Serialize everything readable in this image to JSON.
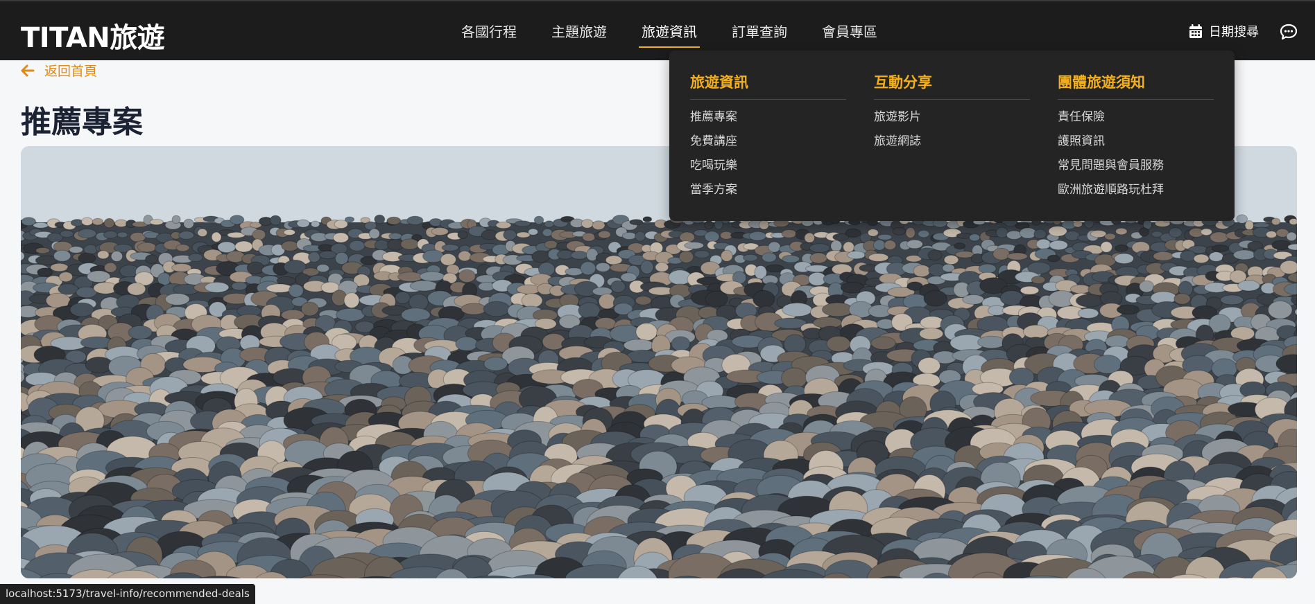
{
  "brand": {
    "logo": "TITAN旅遊"
  },
  "nav": {
    "items": [
      {
        "label": "各國行程"
      },
      {
        "label": "主題旅遊"
      },
      {
        "label": "旅遊資訊"
      },
      {
        "label": "訂單查詢"
      },
      {
        "label": "會員專區"
      }
    ],
    "active_index": 2,
    "date_search_label": "日期搜尋"
  },
  "page": {
    "back_label": "返回首頁",
    "title": "推薦專案",
    "hero_icon": "pebble-beach-photo"
  },
  "mega_menu": {
    "columns": [
      {
        "heading": "旅遊資訊",
        "links": [
          "推薦專案",
          "免費講座",
          "吃喝玩樂",
          "當季方案"
        ]
      },
      {
        "heading": "互動分享",
        "links": [
          "旅遊影片",
          "旅遊網誌"
        ]
      },
      {
        "heading": "團體旅遊須知",
        "links": [
          "責任保險",
          "護照資訊",
          "常見問題與會員服務",
          "歐洲旅遊順路玩杜拜"
        ]
      }
    ]
  },
  "status_bar": {
    "url": "localhost:5173/travel-info/recommended-deals"
  },
  "colors": {
    "header_bg": "#1c1c1c",
    "accent": "#f5b21a",
    "back_link": "#e08a14",
    "title": "#1b2233",
    "menu_bg": "#242424"
  }
}
